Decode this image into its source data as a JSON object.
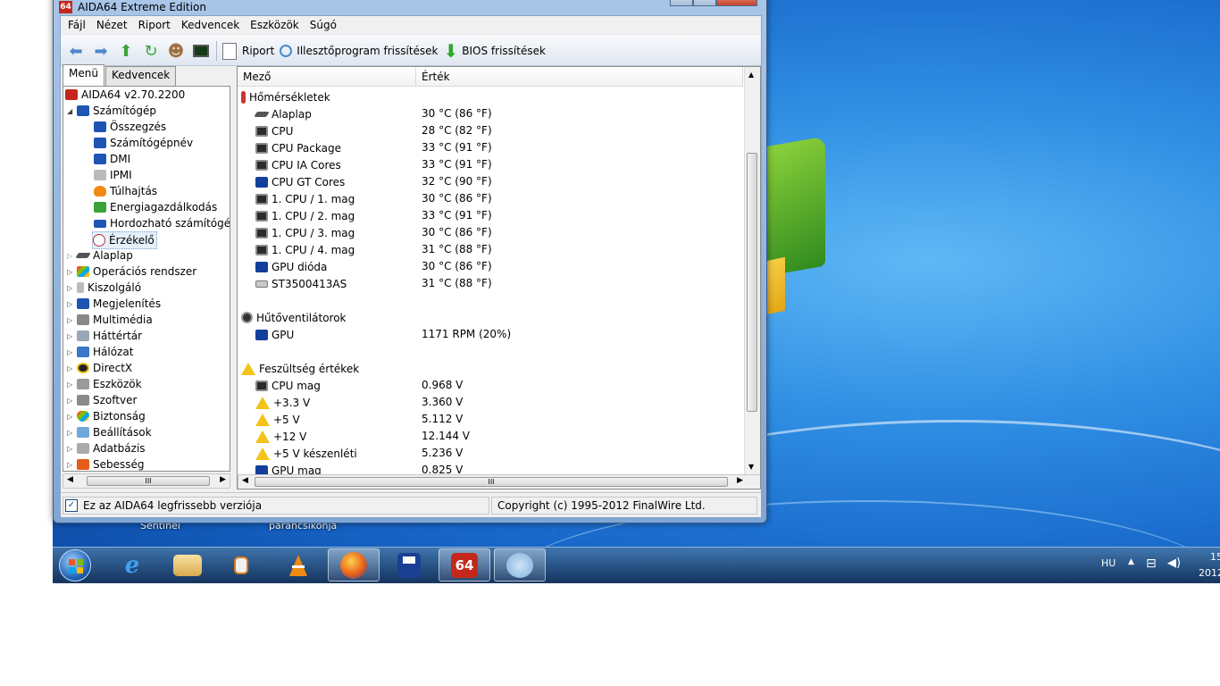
{
  "window": {
    "title": "AIDA64 Extreme Edition",
    "app_icon_text": "64"
  },
  "menubar": [
    "Fájl",
    "Nézet",
    "Riport",
    "Kedvencek",
    "Eszközök",
    "Súgó"
  ],
  "toolbar": {
    "report_label": "Riport",
    "driver_update_label": "Illesztőprogram frissítések",
    "bios_update_label": "BIOS frissítések"
  },
  "left_tabs": [
    "Menü",
    "Kedvencek"
  ],
  "tree": {
    "root": "AIDA64 v2.70.2200",
    "computer": "Számítógép",
    "computer_children": [
      "Összegzés",
      "Számítógépnév",
      "DMI",
      "IPMI",
      "Túlhajtás",
      "Energiagazdálkodás",
      "Hordozható számítógép",
      "Érzékelő"
    ],
    "categories": [
      "Alaplap",
      "Operációs rendszer",
      "Kiszolgáló",
      "Megjelenítés",
      "Multimédia",
      "Háttértár",
      "Hálózat",
      "DirectX",
      "Eszközök",
      "Szoftver",
      "Biztonság",
      "Beállítások",
      "Adatbázis",
      "Sebesség"
    ]
  },
  "columns": {
    "field": "Mező",
    "value": "Érték"
  },
  "sections": {
    "temps_title": "Hőmérsékletek",
    "temps": [
      {
        "icon": "motherboard-icon",
        "name": "Alaplap",
        "value": "30 °C  (86 °F)"
      },
      {
        "icon": "cpu-icon",
        "name": "CPU",
        "value": "28 °C  (82 °F)"
      },
      {
        "icon": "cpu-icon",
        "name": "CPU Package",
        "value": "33 °C  (91 °F)"
      },
      {
        "icon": "cpu-icon",
        "name": "CPU IA Cores",
        "value": "33 °C  (91 °F)"
      },
      {
        "icon": "gpu-icon",
        "name": "CPU GT Cores",
        "value": "32 °C  (90 °F)"
      },
      {
        "icon": "cpu-icon",
        "name": "1. CPU / 1. mag",
        "value": "30 °C  (86 °F)"
      },
      {
        "icon": "cpu-icon",
        "name": "1. CPU / 2. mag",
        "value": "33 °C  (91 °F)"
      },
      {
        "icon": "cpu-icon",
        "name": "1. CPU / 3. mag",
        "value": "30 °C  (86 °F)"
      },
      {
        "icon": "cpu-icon",
        "name": "1. CPU / 4. mag",
        "value": "31 °C  (88 °F)"
      },
      {
        "icon": "gpu-icon",
        "name": "GPU dióda",
        "value": "30 °C  (86 °F)"
      },
      {
        "icon": "hdd-icon",
        "name": "ST3500413AS",
        "value": "31 °C  (88 °F)"
      }
    ],
    "fans_title": "Hűtőventilátorok",
    "fans": [
      {
        "icon": "gpu-icon",
        "name": "GPU",
        "value": "1171 RPM  (20%)"
      }
    ],
    "volts_title": "Feszültség értékek",
    "volts": [
      {
        "icon": "cpu-icon",
        "name": "CPU mag",
        "value": "0.968 V"
      },
      {
        "icon": "warning-icon",
        "name": "+3.3 V",
        "value": "3.360 V"
      },
      {
        "icon": "warning-icon",
        "name": "+5 V",
        "value": "5.112 V"
      },
      {
        "icon": "warning-icon",
        "name": "+12 V",
        "value": "12.144 V"
      },
      {
        "icon": "warning-icon",
        "name": "+5 V készenléti",
        "value": "5.236 V"
      },
      {
        "icon": "gpu-icon",
        "name": "GPU mag",
        "value": "0.825 V"
      }
    ]
  },
  "statusbar": {
    "latest_version": "Ez az AIDA64 legfrissebb verziója",
    "copyright": "Copyright (c) 1995-2012 FinalWire Ltd."
  },
  "desktop_labels": [
    "Sentinel",
    "parancsikonja"
  ],
  "tray": {
    "language": "HU",
    "time": "15",
    "date": "2012"
  },
  "scroll_glyph": "III"
}
